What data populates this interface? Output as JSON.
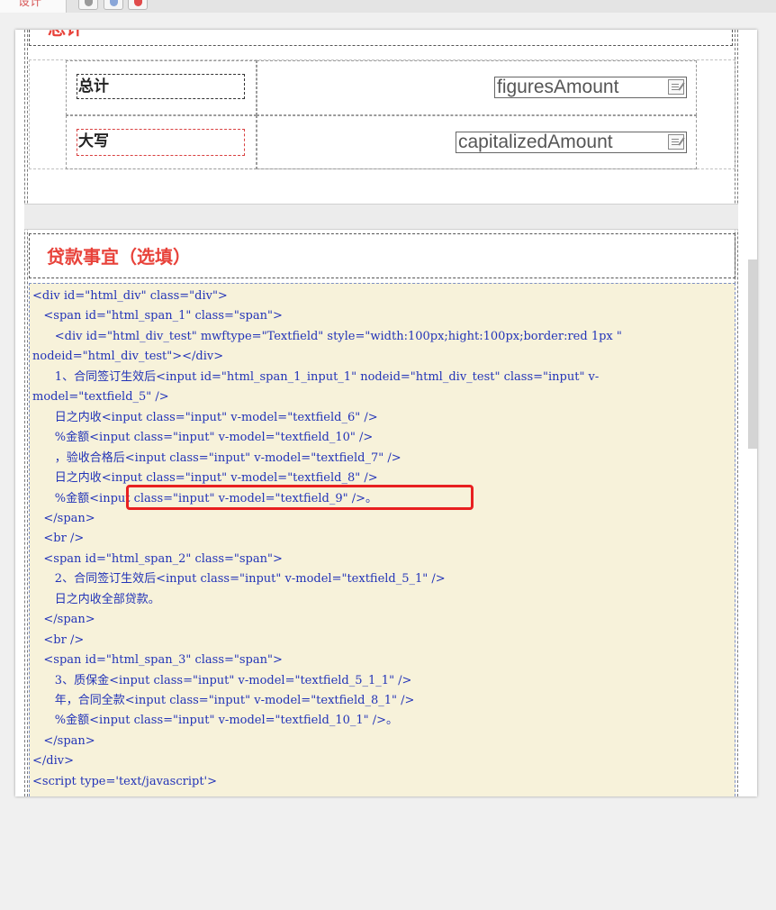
{
  "toolbar": {
    "design_tab": "设计",
    "icons": [
      "add-icon",
      "copy-icon",
      "record-icon"
    ]
  },
  "section_totals": {
    "title": "总计",
    "rows": [
      {
        "label": "总计",
        "field": "figuresAmount"
      },
      {
        "label": "大写",
        "field": "capitalizedAmount"
      }
    ]
  },
  "section_loan": {
    "title": "贷款事宜（选填）",
    "code_lines": [
      "<div id=\"html_div\" class=\"div\">",
      "   <span id=\"html_span_1\" class=\"span\">",
      "      <div id=\"html_div_test\" mwftype=\"Textfield\" style=\"width:100px;hight:100px;border:red 1px \"",
      "nodeid=\"html_div_test\"></div>",
      "      1、合同签订生效后<input id=\"html_span_1_input_1\" nodeid=\"html_div_test\" class=\"input\" v-",
      "model=\"textfield_5\" />",
      "      日之内收<input class=\"input\" v-model=\"textfield_6\" />",
      "      %金额<input class=\"input\" v-model=\"textfield_10\" />",
      "      ，验收合格后<input class=\"input\" v-model=\"textfield_7\" />",
      "      日之内收<input class=\"input\" v-model=\"textfield_8\" />",
      "      %金额<input class=\"input\" v-model=\"textfield_9\" />。",
      "   </span>",
      "   <br />",
      "   <span id=\"html_span_2\" class=\"span\">",
      "      2、合同签订生效后<input class=\"input\" v-model=\"textfield_5_1\" />",
      "      日之内收全部贷款。",
      "   </span>",
      "   <br />",
      "   <span id=\"html_span_3\" class=\"span\">",
      "      3、质保金<input class=\"input\" v-model=\"textfield_5_1_1\" />",
      "      年，合同全款<input class=\"input\" v-model=\"textfield_8_1\" />",
      "      %金额<input class=\"input\" v-model=\"textfield_10_1\" />。",
      "   </span>",
      "</div>",
      "<script type='text/javascript'>"
    ]
  },
  "colors": {
    "section_title": "#e8423a",
    "code_text": "#2233b8",
    "code_bg": "#f7f2da",
    "highlight": "#e82020"
  }
}
